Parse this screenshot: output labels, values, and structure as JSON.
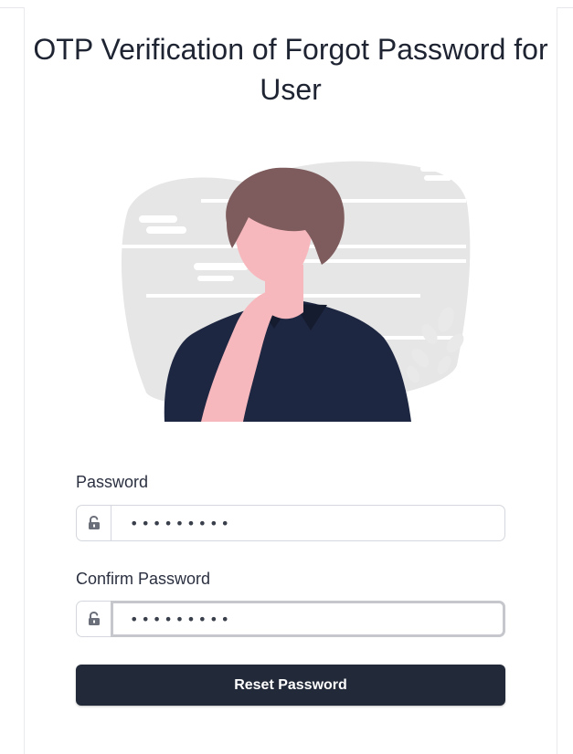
{
  "page": {
    "title": "OTP Verification of Forgot Password for User"
  },
  "form": {
    "password": {
      "label": "Password",
      "value": "•••••••••",
      "icon": "unlock-icon"
    },
    "confirm_password": {
      "label": "Confirm Password",
      "value": "•••••••••",
      "icon": "unlock-icon",
      "focused": true
    },
    "submit_label": "Reset Password"
  },
  "colors": {
    "button_bg": "#222938",
    "text": "#1f2433",
    "skin": "#f7b8bd",
    "hair": "#7e5b5c",
    "shirt": "#1e2742",
    "backdrop": "#e6e6e6"
  }
}
